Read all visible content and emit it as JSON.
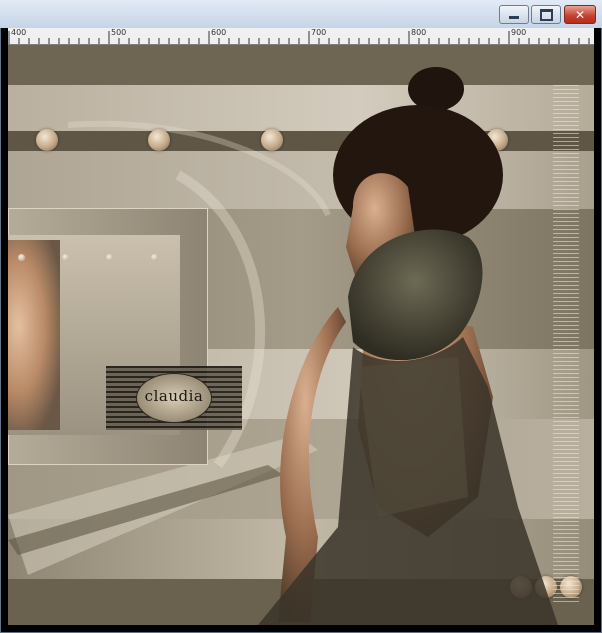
{
  "window": {
    "controls": {
      "minimize": "minimize-icon",
      "maximize": "maximize-icon",
      "close": "close-icon"
    }
  },
  "ruler": {
    "ticks": [
      "400",
      "500",
      "600",
      "700",
      "800",
      "900"
    ]
  },
  "artwork": {
    "watermark_text": "claudia"
  },
  "colors": {
    "canvas_bg": "#6e6553",
    "accent_beige": "#b5ab99",
    "titlebar": "#dbe6f2",
    "close_button": "#c33e2b"
  }
}
